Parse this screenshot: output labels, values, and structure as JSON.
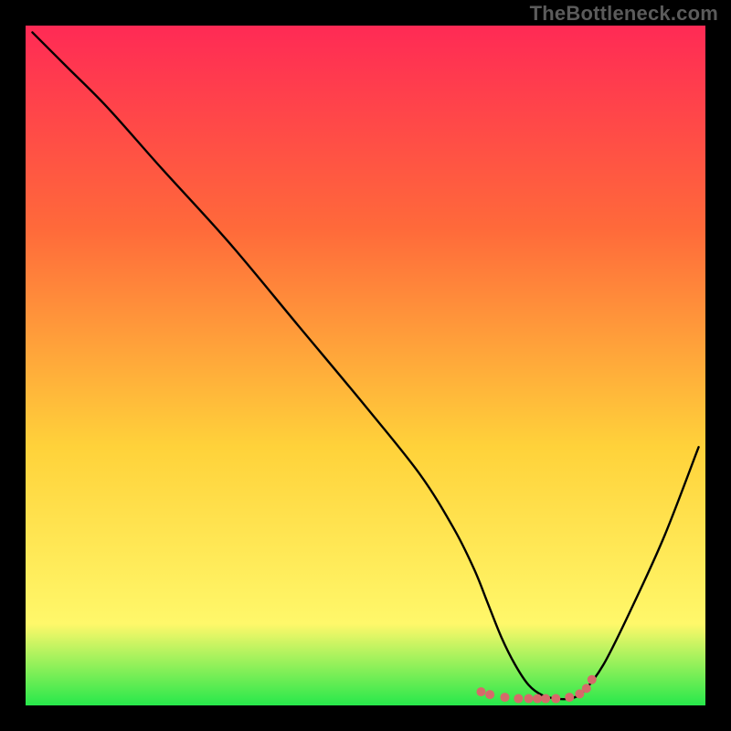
{
  "watermark": "TheBottleneck.com",
  "colors": {
    "background": "#000000",
    "gradient_top": "#ff2a55",
    "gradient_mid1": "#ff6a3a",
    "gradient_mid2": "#ffd23a",
    "gradient_low": "#fff86a",
    "gradient_bottom": "#27e84b",
    "curve": "#000000",
    "markers": "#d66a6a"
  },
  "chart_data": {
    "type": "line",
    "title": "",
    "xlabel": "",
    "ylabel": "",
    "xlim": [
      0,
      100
    ],
    "ylim": [
      0,
      100
    ],
    "grid": false,
    "series": [
      {
        "name": "bottleneck-curve",
        "x": [
          1,
          6,
          12,
          20,
          30,
          40,
          50,
          58,
          63,
          66,
          68,
          70,
          72,
          74,
          76,
          78,
          80,
          82,
          85,
          89,
          94,
          99
        ],
        "y": [
          99,
          94,
          88,
          79,
          68,
          56,
          44,
          34,
          26,
          20,
          15,
          10,
          6,
          3,
          1.5,
          1,
          1,
          2,
          6,
          14,
          25,
          38
        ]
      }
    ],
    "markers": {
      "name": "optimal-zone-markers",
      "x": [
        67.0,
        68.3,
        70.5,
        72.5,
        74.0,
        75.3,
        76.5,
        78.0,
        80.0,
        81.5,
        82.5,
        83.3
      ],
      "y": [
        2.0,
        1.6,
        1.2,
        1.0,
        1.0,
        1.0,
        1.0,
        1.0,
        1.2,
        1.7,
        2.5,
        3.8
      ]
    },
    "annotations": []
  }
}
